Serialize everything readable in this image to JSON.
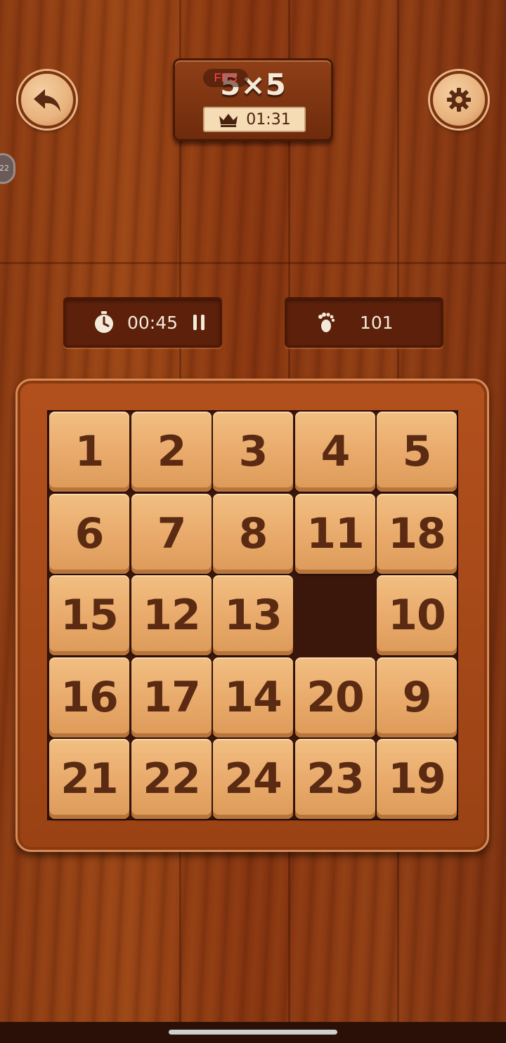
{
  "header": {
    "title": "5×5",
    "fps_label": "FPS",
    "best_time": "01:31",
    "back_icon": "back-arrow-icon",
    "settings_icon": "gear-icon",
    "best_icon": "crown-icon"
  },
  "side_badge": {
    "text": "22"
  },
  "stats": {
    "timer": "00:45",
    "moves": "101",
    "timer_icon": "stopwatch-icon",
    "pause_icon": "pause-icon",
    "moves_icon": "footprints-icon"
  },
  "board": {
    "size": "5x5",
    "rows": [
      [
        "1",
        "2",
        "3",
        "4",
        "5"
      ],
      [
        "6",
        "7",
        "8",
        "11",
        "18"
      ],
      [
        "15",
        "12",
        "13",
        "",
        "10"
      ],
      [
        "16",
        "17",
        "14",
        "20",
        "9"
      ],
      [
        "21",
        "22",
        "24",
        "23",
        "19"
      ]
    ]
  },
  "colors": {
    "tile": "#e8a96a",
    "tile_text": "#5a2a12",
    "frame": "#a8481a",
    "empty_slot": "#3b160b"
  }
}
